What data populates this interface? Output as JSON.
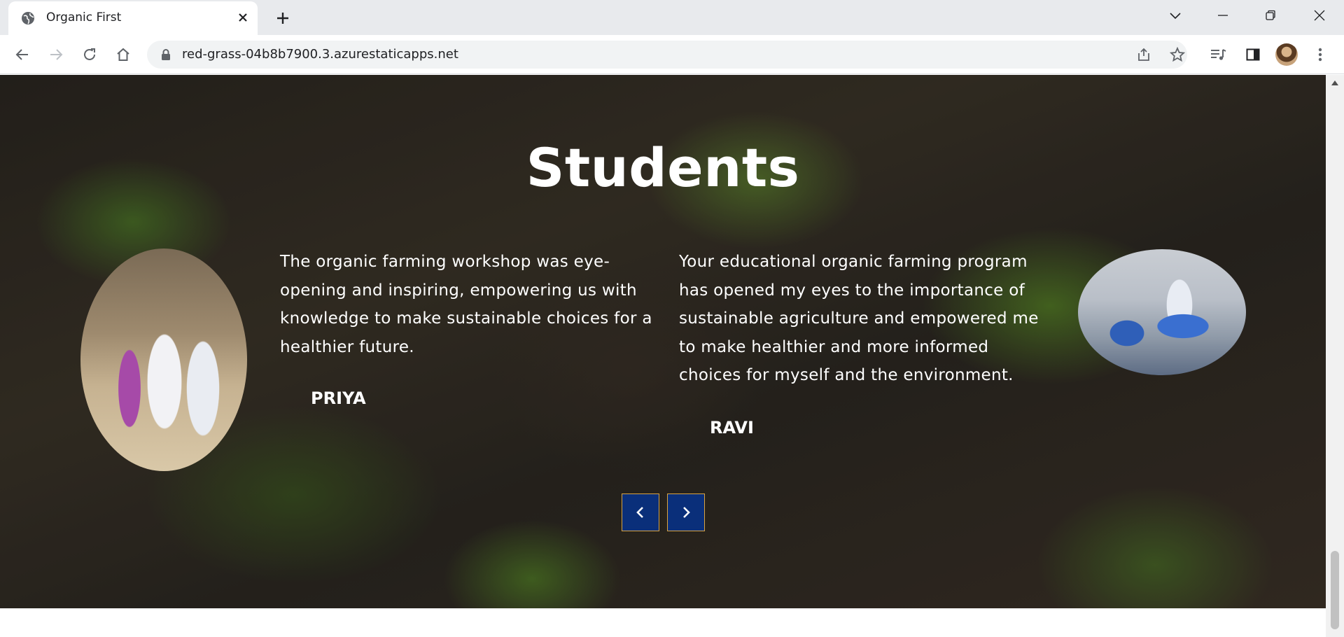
{
  "browser": {
    "tab_title": "Organic First",
    "url": "red-grass-04b8b7900.3.azurestaticapps.net",
    "icons": {
      "favicon": "globe-icon",
      "tab_close": "close-icon",
      "new_tab": "plus-icon",
      "tab_search": "chevron-down-icon",
      "minimize": "minimize-icon",
      "restore": "restore-icon",
      "close_window": "close-icon",
      "back": "arrow-left-icon",
      "forward": "arrow-right-icon",
      "reload": "reload-icon",
      "home": "home-icon",
      "lock": "lock-icon",
      "share": "share-icon",
      "bookmark": "star-icon",
      "media": "media-control-icon",
      "side_panel": "side-panel-icon",
      "profile": "avatar",
      "menu": "kebab-menu-icon"
    }
  },
  "section": {
    "title": "Students"
  },
  "testimonials": [
    {
      "quote": "The organic farming workshop was eye-opening and inspiring, empowering us with knowledge to make sustainable choices for a healthier future.",
      "name": "PRIYA"
    },
    {
      "quote": "Your educational organic farming program has opened my eyes to the importance of sustainable agriculture and empowered me to make healthier and more informed choices for myself and the environment.",
      "name": "RAVI"
    }
  ],
  "carousel": {
    "prev_icon": "chevron-left-icon",
    "next_icon": "chevron-right-icon"
  },
  "colors": {
    "arrow_bg": "#0a2f7a",
    "arrow_border": "#d9a441",
    "text": "#ffffff"
  }
}
